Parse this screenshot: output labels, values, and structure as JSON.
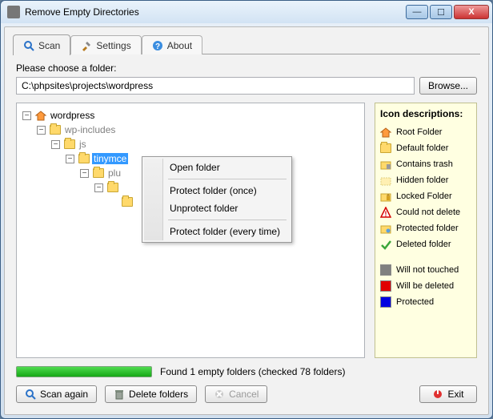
{
  "window": {
    "title": "Remove Empty Directories"
  },
  "tabs": {
    "scan": "Scan",
    "settings": "Settings",
    "about": "About"
  },
  "choose_label": "Please choose a folder:",
  "path_value": "C:\\phpsites\\projects\\wordpress",
  "browse_label": "Browse...",
  "tree": {
    "root": "wordpress",
    "n1": "wp-includes",
    "n2": "js",
    "n3": "tinymce",
    "n4": "plu",
    "n5": "",
    "n6": ""
  },
  "ctx": {
    "open": "Open folder",
    "protect_once": "Protect folder (once)",
    "unprotect": "Unprotect folder",
    "protect_every": "Protect folder (every time)"
  },
  "legend": {
    "title": "Icon descriptions:",
    "root": "Root Folder",
    "default": "Default folder",
    "trash": "Contains trash",
    "hidden": "Hidden folder",
    "locked": "Locked Folder",
    "nodel": "Could not delete",
    "protected": "Protected folder",
    "deleted": "Deleted folder",
    "untouched": "Will not touched",
    "willdel": "Will be deleted",
    "prot": "Protected"
  },
  "status": "Found 1 empty folders (checked 78 folders)",
  "buttons": {
    "scan_again": "Scan again",
    "delete": "Delete folders",
    "cancel": "Cancel",
    "exit": "Exit"
  }
}
